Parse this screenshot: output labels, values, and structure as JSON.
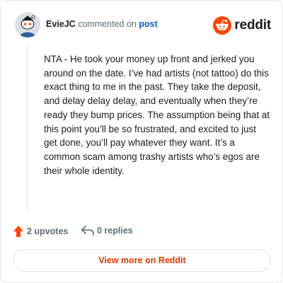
{
  "header": {
    "username": "EvieJC",
    "action_text": "commented on",
    "post_link_label": "post",
    "brand_name": "reddit"
  },
  "comment": {
    "body": "NTA - He took your money up front and jerked you around on the date. I’ve had artists (not tattoo) do this exact thing to me in the past. They take the deposit, and delay delay delay, and eventually when they’re ready they bump prices. The assumption being that at this point you’ll be so frustrated, and excited to just get done, you’ll pay whatever they want. It’s a common scam among trashy artists who’s egos are their whole identity."
  },
  "footer": {
    "upvotes_label": "2 upvotes",
    "replies_label": "0 replies"
  },
  "cta": {
    "view_more_label": "View more on Reddit"
  },
  "colors": {
    "brand_orange": "#ff4500",
    "upvote_orange": "#ff4500",
    "link_blue": "#0b57c5",
    "cta_text": "#d93a00",
    "meta_gray": "#576f76"
  },
  "icons": {
    "avatar": "snoo-avatar-icon",
    "brand": "reddit-logo-icon",
    "upvote": "upvote-arrow-icon",
    "reply": "reply-arrow-icon"
  }
}
